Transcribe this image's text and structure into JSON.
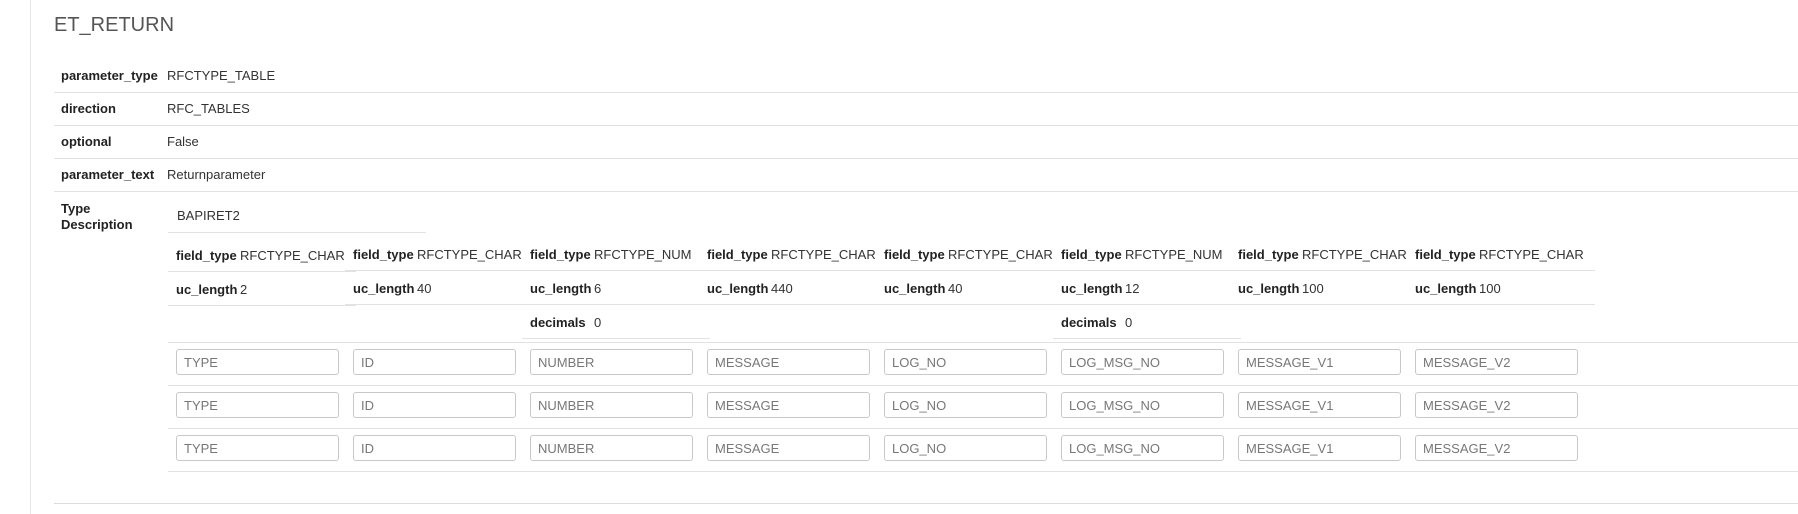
{
  "section": {
    "title": "ET_RETURN"
  },
  "params": [
    {
      "key": "parameter_type",
      "value": "RFCTYPE_TABLE"
    },
    {
      "key": "direction",
      "value": "RFC_TABLES"
    },
    {
      "key": "optional",
      "value": "False"
    },
    {
      "key": "parameter_text",
      "value": "Returnparameter"
    }
  ],
  "type_description": {
    "label": "Type Description",
    "name": "BAPIRET2",
    "fields": [
      {
        "rows": [
          {
            "k": "field_type",
            "v": "RFCTYPE_CHAR"
          },
          {
            "k": "uc_length",
            "v": "2"
          }
        ]
      },
      {
        "rows": [
          {
            "k": "field_type",
            "v": "RFCTYPE_CHAR"
          },
          {
            "k": "uc_length",
            "v": "40"
          }
        ]
      },
      {
        "rows": [
          {
            "k": "field_type",
            "v": "RFCTYPE_NUM"
          },
          {
            "k": "uc_length",
            "v": "6"
          },
          {
            "k": "decimals",
            "v": "0"
          }
        ]
      },
      {
        "rows": [
          {
            "k": "field_type",
            "v": "RFCTYPE_CHAR"
          },
          {
            "k": "uc_length",
            "v": "440"
          }
        ]
      },
      {
        "rows": [
          {
            "k": "field_type",
            "v": "RFCTYPE_CHAR"
          },
          {
            "k": "uc_length",
            "v": "40"
          }
        ]
      },
      {
        "rows": [
          {
            "k": "field_type",
            "v": "RFCTYPE_NUM"
          },
          {
            "k": "uc_length",
            "v": "12"
          },
          {
            "k": "decimals",
            "v": "0"
          }
        ]
      },
      {
        "rows": [
          {
            "k": "field_type",
            "v": "RFCTYPE_CHAR"
          },
          {
            "k": "uc_length",
            "v": "100"
          }
        ]
      },
      {
        "rows": [
          {
            "k": "field_type",
            "v": "RFCTYPE_CHAR"
          },
          {
            "k": "uc_length",
            "v": "100"
          }
        ]
      }
    ],
    "input_placeholders": [
      "TYPE",
      "ID",
      "NUMBER",
      "MESSAGE",
      "LOG_NO",
      "LOG_MSG_NO",
      "MESSAGE_V1",
      "MESSAGE_V2"
    ],
    "input_rows": 3
  }
}
